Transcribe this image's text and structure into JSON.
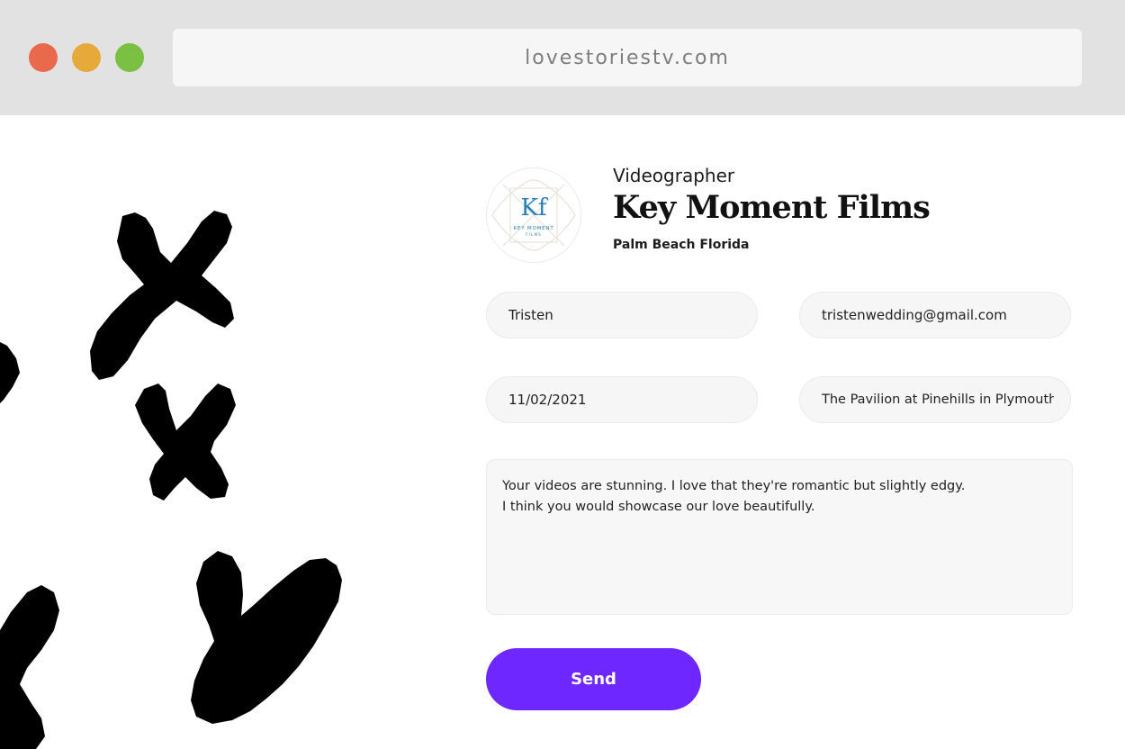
{
  "browser": {
    "url": "lovestoriestv.com",
    "traffic_lights": {
      "close": "#e9694c",
      "minimize": "#e6a93a",
      "maximize": "#7cc043"
    }
  },
  "vendor": {
    "category": "Videographer",
    "name": "Key Moment Films",
    "location": "Palm Beach Florida",
    "logo": {
      "monogram": "Kf",
      "line1": "KEY MOMENT",
      "line2": "FILMS"
    }
  },
  "form": {
    "name_value": "Tristen",
    "email_value": "tristenwedding@gmail.com",
    "date_value": "11/02/2021",
    "venue_value": "The Pavilion at Pinehills in Plymouth",
    "message_value": "Your videos are stunning. I love that they're romantic but slightly edgy.\nI think you would showcase our love beautifully.",
    "send_label": "Send"
  },
  "colors": {
    "accent": "#6e28ff",
    "titlebar": "#e2e2e2",
    "field_background": "#f6f6f6"
  }
}
